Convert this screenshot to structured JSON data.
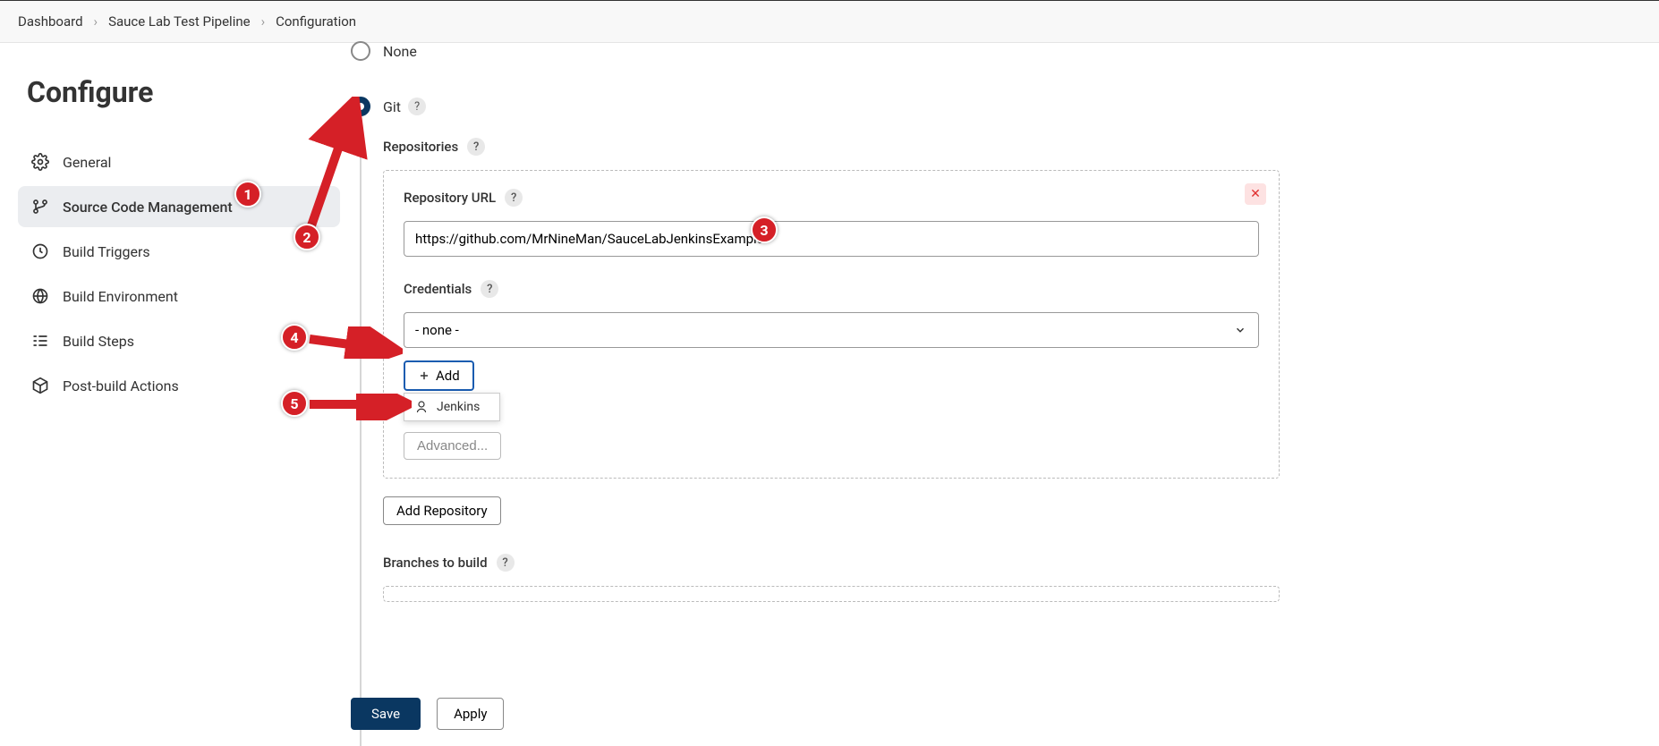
{
  "breadcrumb": {
    "root": "Dashboard",
    "project": "Sauce Lab Test Pipeline",
    "page": "Configuration"
  },
  "sidebar": {
    "title": "Configure",
    "items": [
      {
        "label": "General"
      },
      {
        "label": "Source Code Management"
      },
      {
        "label": "Build Triggers"
      },
      {
        "label": "Build Environment"
      },
      {
        "label": "Build Steps"
      },
      {
        "label": "Post-build Actions"
      }
    ]
  },
  "scm": {
    "none_label": "None",
    "git_label": "Git",
    "repositories_label": "Repositories",
    "repo_url_label": "Repository URL",
    "repo_url_value": "https://github.com/MrNineMan/SauceLabJenkinsExample",
    "credentials_label": "Credentials",
    "credentials_value": "- none -",
    "add_label": "Add",
    "dropdown_item": "Jenkins",
    "advanced_label": "Advanced...",
    "add_repository_label": "Add Repository",
    "branches_label": "Branches to build"
  },
  "footer": {
    "save": "Save",
    "apply": "Apply"
  },
  "help": "?",
  "annotations": {
    "1": "1",
    "2": "2",
    "3": "3",
    "4": "4",
    "5": "5"
  }
}
